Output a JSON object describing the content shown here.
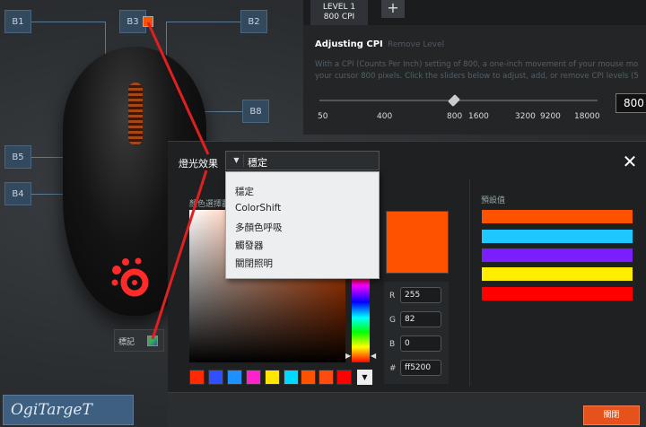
{
  "background": {
    "pads": [
      "B1",
      "B3",
      "B2",
      "B8",
      "B5",
      "B4"
    ],
    "tabs": {
      "level_line1": "LEVEL 1",
      "level_line2": "800 CPI",
      "add": "+"
    },
    "cpi": {
      "title": "Adjusting CPI",
      "remove": "Remove Level",
      "desc_line1": "With a CPI (Counts Per Inch) setting of 800, a one-inch movement of your mouse mo",
      "desc_line2": "your cursor 800 pixels. Click the sliders below to adjust, add, or remove CPI levels (5",
      "ticks": [
        "50",
        "400",
        "800",
        "1600",
        "3200",
        "9200",
        "18000"
      ],
      "value": "800"
    },
    "binding_label": "標記",
    "watermark": "OgiTargeT"
  },
  "dialog": {
    "title": "燈光效果",
    "dropdown_value": "穩定",
    "dropdown_options": [
      "穩定",
      "ColorShift",
      "多顏色呼吸",
      "觸發器",
      "關閉照明"
    ],
    "picker_label": "顏色選擇器",
    "rgb": {
      "r_label": "R",
      "r": "255",
      "g_label": "G",
      "g": "82",
      "b_label": "B",
      "b": "0",
      "hex_label": "#",
      "hex": "ff5200"
    },
    "swatches": [
      "#ff2a00",
      "#3050ff",
      "#1e90ff",
      "#ff22cc",
      "#ffe600",
      "#00d8ff",
      "#ff5200",
      "#ff4a10",
      "#ff0000"
    ],
    "preset_label": "預設值",
    "presets": [
      "#ff5200",
      "#1ec8ff",
      "#7a1eff",
      "#ffee00",
      "#ff0000"
    ],
    "close_button": "關閉"
  },
  "colors": {
    "accent": "#ff5200",
    "annotation": "#e02020"
  }
}
